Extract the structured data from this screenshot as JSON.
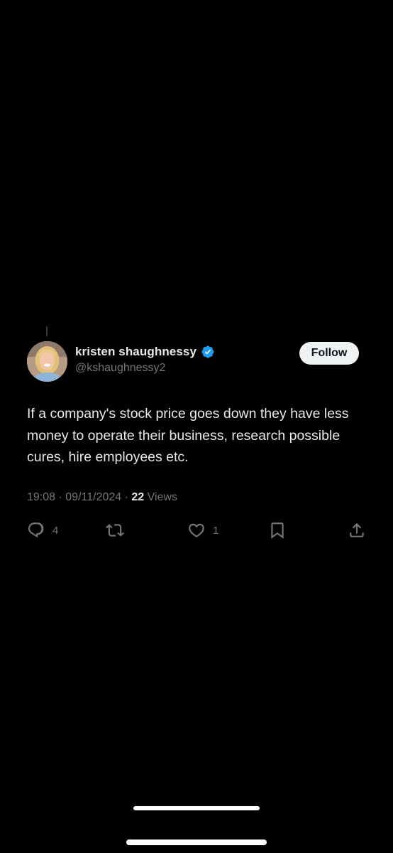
{
  "author": {
    "display_name": "kristen shaughnessy",
    "handle": "@kshaughnessy2",
    "verified": true,
    "verified_color": "#1d9bf0",
    "avatar_icon": "profile-photo"
  },
  "follow_button": {
    "label": "Follow"
  },
  "tweet": {
    "text": "If a company's stock price goes down they have less money to operate their business, research possible cures, hire employees etc.",
    "time": "19:08",
    "separator": "·",
    "date": "09/11/2024",
    "views_count": "22",
    "views_label": "Views"
  },
  "actions": {
    "reply": {
      "icon": "reply-icon",
      "count": "4"
    },
    "retweet": {
      "icon": "retweet-icon",
      "count": ""
    },
    "like": {
      "icon": "heart-icon",
      "count": "1"
    },
    "bookmark": {
      "icon": "bookmark-icon"
    },
    "share": {
      "icon": "share-icon"
    }
  },
  "colors": {
    "background": "#000000",
    "primary_text": "#e7e9ea",
    "secondary_text": "#71767b",
    "follow_bg": "#eff3f4"
  }
}
